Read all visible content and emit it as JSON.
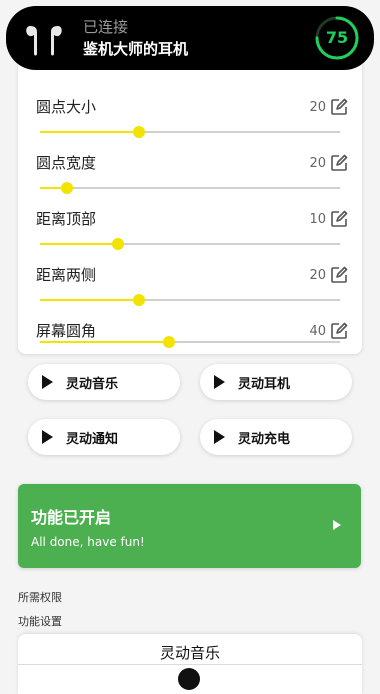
{
  "island": {
    "status": "已连接",
    "device": "鉴机大师的耳机",
    "battery": "75",
    "battery_level": 0.75,
    "battery_color": "#1fd15b",
    "icon": "earbuds-icon"
  },
  "settings": {
    "rows": [
      {
        "label": "圆点大小",
        "value": "20",
        "level": 0.33
      },
      {
        "label": "圆点宽度",
        "value": "20",
        "level": 0.09
      },
      {
        "label": "距离顶部",
        "value": "10",
        "level": 0.26
      },
      {
        "label": "距离两侧",
        "value": "20",
        "level": 0.33
      },
      {
        "label": "屏幕圆角",
        "value": "40",
        "level": 0.43
      }
    ],
    "edit_icon": "edit-icon",
    "slider_color": "#f3e300"
  },
  "buttons": [
    {
      "label": "灵动音乐",
      "icon": "play-icon"
    },
    {
      "label": "灵动耳机",
      "icon": "play-icon"
    },
    {
      "label": "灵动通知",
      "icon": "play-icon"
    },
    {
      "label": "灵动充电",
      "icon": "play-icon"
    }
  ],
  "status_card": {
    "title": "功能已开启",
    "subtitle": "All done, have fun!",
    "color": "#4caf50",
    "icon": "play-icon"
  },
  "sections": {
    "permissions": "所需权限",
    "settings": "功能设置"
  },
  "bottom_card": {
    "title": "灵动音乐"
  }
}
